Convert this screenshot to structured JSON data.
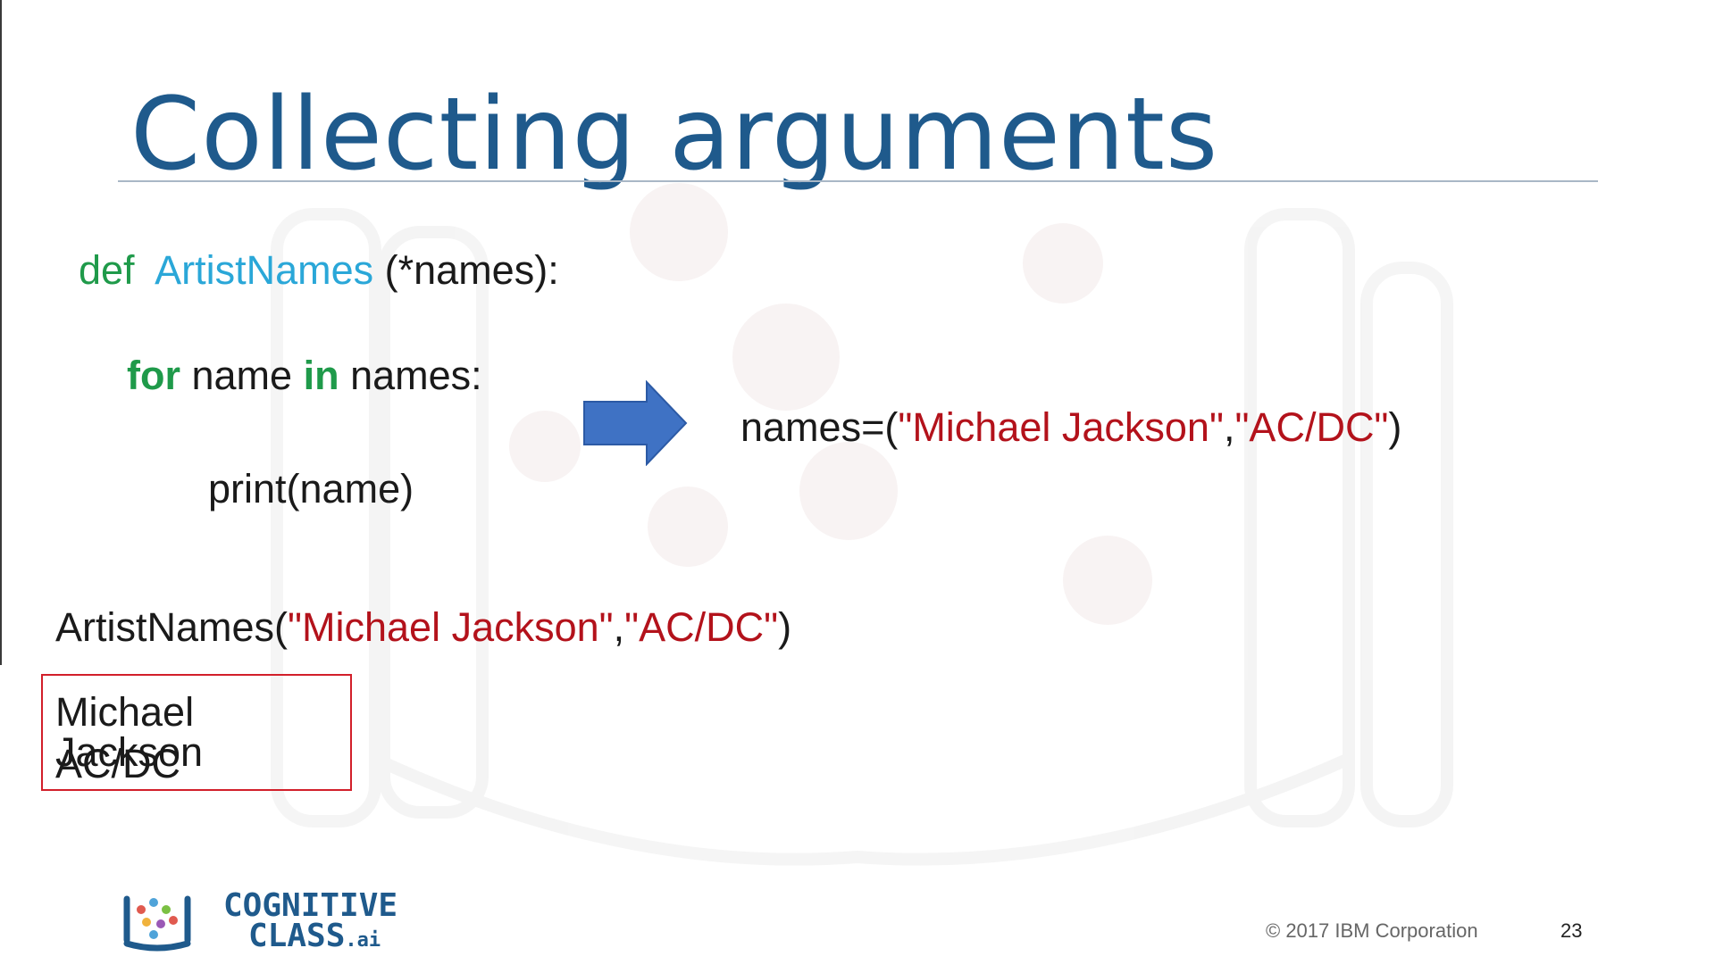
{
  "slide": {
    "title": "Collecting arguments",
    "code": {
      "def_keyword": "def",
      "function_name": "ArtistNames",
      "params": " (*names):",
      "for_keyword": "for",
      "for_middle": " name ",
      "in_keyword": "in",
      "for_end": " names:",
      "print_line": "print(name)",
      "call_prefix": "ArtistNames(",
      "call_arg1": "\"Michael Jackson\"",
      "call_sep": ",",
      "call_arg2": "\"AC/DC\"",
      "call_suffix": ")"
    },
    "tuple_display": {
      "prefix": "names=(",
      "arg1": "\"Michael Jackson\"",
      "sep": ",",
      "arg2": "\"AC/DC\"",
      "suffix": ")"
    },
    "output": {
      "line1": "Michael Jackson",
      "line2": "AC/DC"
    },
    "arrow_icon": "right-arrow-icon"
  },
  "footer": {
    "logo_line1": "COGNITIVE",
    "logo_line2": "CLASS",
    "logo_suffix": ".ai",
    "copyright": "© 2017 IBM Corporation",
    "page_number": "23"
  },
  "colors": {
    "title": "#1f5a8c",
    "keyword": "#1f9a4a",
    "function": "#2aa7d8",
    "string": "#b3121b",
    "arrow": "#3f72c4",
    "output_border": "#d21f2a"
  }
}
